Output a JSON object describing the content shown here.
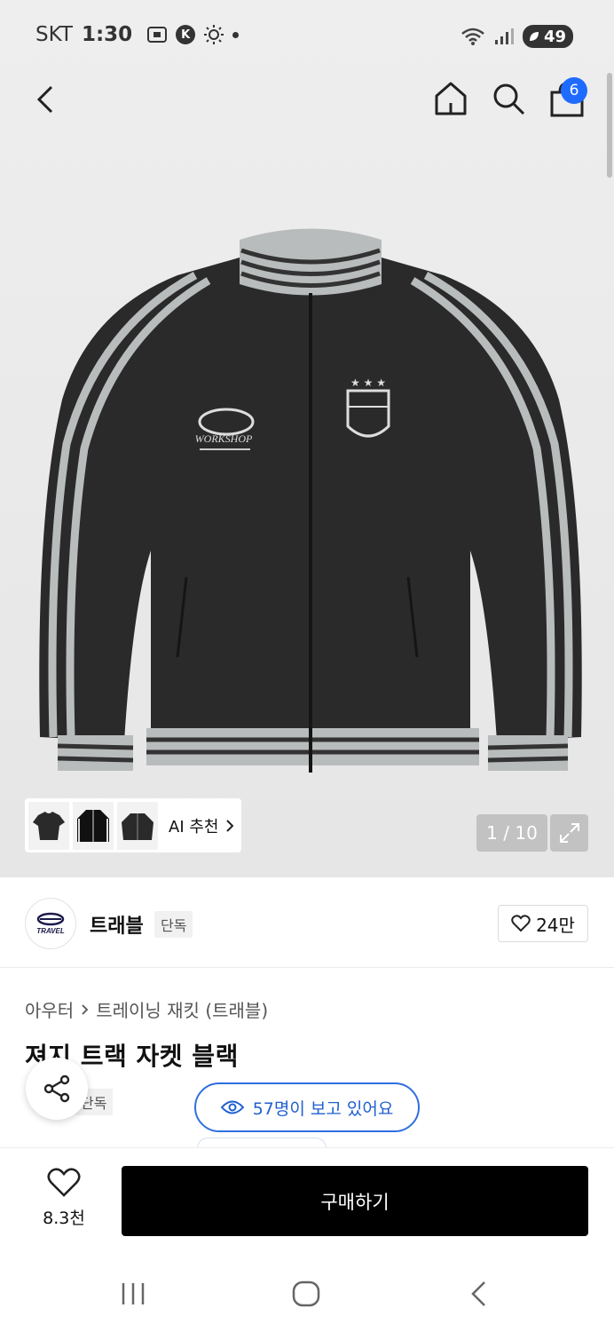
{
  "status": {
    "carrier": "SKT",
    "time": "1:30",
    "k_badge": "K",
    "battery": "49"
  },
  "header": {
    "cart_count": "6"
  },
  "gallery": {
    "ai_label": "AI 추천",
    "counter": "1 / 10"
  },
  "brand": {
    "name": "트래블",
    "tag": "단독",
    "likes": "24만",
    "logo_text": "TRAVEL"
  },
  "product": {
    "breadcrumb": [
      "아우터",
      "트레이닝 재킷 (트래블)"
    ],
    "title": "져지 트랙 자켓 블랙",
    "exclusive_tag": "단독",
    "viewers": "57명이 보고 있어요",
    "jacket_print": "WORKSHOP"
  },
  "bottom": {
    "wish_count": "8.3천",
    "buy_label": "구매하기"
  },
  "colors": {
    "accent": "#1f6bff",
    "viewer_blue": "#2f6fe0",
    "buy_bg": "#000000"
  }
}
